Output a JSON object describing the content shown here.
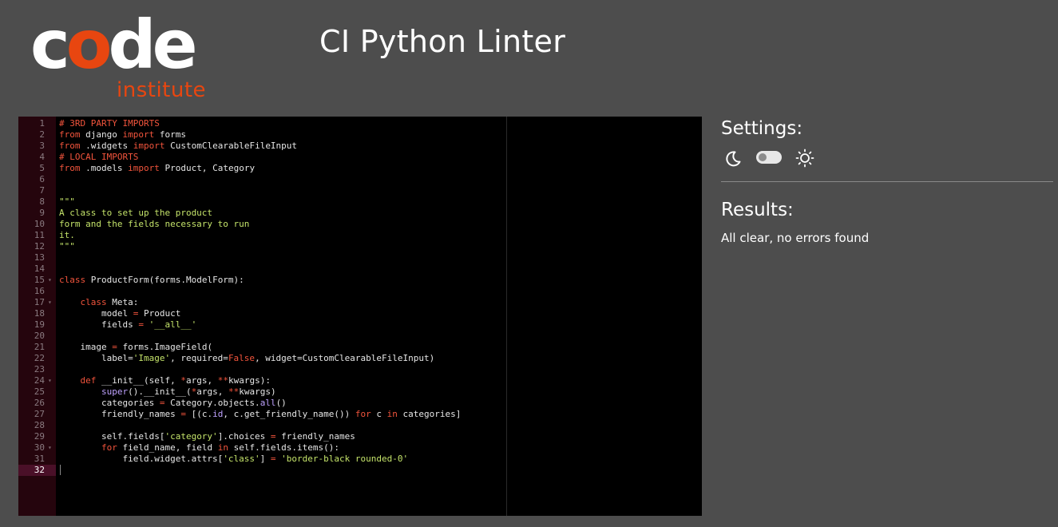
{
  "logo": {
    "word_c": "c",
    "word_o": "o",
    "word_de": "de",
    "subtitle": "institute"
  },
  "app": {
    "title": "CI Python Linter"
  },
  "colors": {
    "brand_orange": "#e84610",
    "background": "#4d4d4d",
    "editor_bg": "#000000",
    "gutter_bg": "#25050d",
    "keyword": "#f2543c",
    "string": "#c4e36a",
    "builtin": "#bfa2ff"
  },
  "editor": {
    "active_line": 32,
    "lines": [
      {
        "n": "1",
        "fold": "",
        "tokens": [
          {
            "c": "cm",
            "t": "# 3RD PARTY IMPORTS"
          }
        ]
      },
      {
        "n": "2",
        "fold": "",
        "tokens": [
          {
            "c": "kw",
            "t": "from"
          },
          {
            "c": "pl",
            "t": " django "
          },
          {
            "c": "kw",
            "t": "import"
          },
          {
            "c": "pl",
            "t": " forms"
          }
        ]
      },
      {
        "n": "3",
        "fold": "",
        "tokens": [
          {
            "c": "kw",
            "t": "from"
          },
          {
            "c": "pl",
            "t": " .widgets "
          },
          {
            "c": "kw",
            "t": "import"
          },
          {
            "c": "pl",
            "t": " CustomClearableFileInput"
          }
        ]
      },
      {
        "n": "4",
        "fold": "",
        "tokens": [
          {
            "c": "cm",
            "t": "# LOCAL IMPORTS"
          }
        ]
      },
      {
        "n": "5",
        "fold": "",
        "tokens": [
          {
            "c": "kw",
            "t": "from"
          },
          {
            "c": "pl",
            "t": " .models "
          },
          {
            "c": "kw",
            "t": "import"
          },
          {
            "c": "pl",
            "t": " Product, Category"
          }
        ]
      },
      {
        "n": "6",
        "fold": "",
        "tokens": []
      },
      {
        "n": "7",
        "fold": "",
        "tokens": []
      },
      {
        "n": "8",
        "fold": "",
        "tokens": [
          {
            "c": "st",
            "t": "\"\"\""
          }
        ]
      },
      {
        "n": "9",
        "fold": "",
        "tokens": [
          {
            "c": "st",
            "t": "A class to set up the product"
          }
        ]
      },
      {
        "n": "10",
        "fold": "",
        "tokens": [
          {
            "c": "st",
            "t": "form and the fields necessary to run"
          }
        ]
      },
      {
        "n": "11",
        "fold": "",
        "tokens": [
          {
            "c": "st",
            "t": "it."
          }
        ]
      },
      {
        "n": "12",
        "fold": "",
        "tokens": [
          {
            "c": "st",
            "t": "\"\"\""
          }
        ]
      },
      {
        "n": "13",
        "fold": "",
        "tokens": []
      },
      {
        "n": "14",
        "fold": "",
        "tokens": []
      },
      {
        "n": "15",
        "fold": "▾",
        "tokens": [
          {
            "c": "kw",
            "t": "class"
          },
          {
            "c": "pl",
            "t": " ProductForm(forms.ModelForm):"
          }
        ]
      },
      {
        "n": "16",
        "fold": "",
        "tokens": []
      },
      {
        "n": "17",
        "fold": "▾",
        "tokens": [
          {
            "c": "pl",
            "t": "    "
          },
          {
            "c": "kw",
            "t": "class"
          },
          {
            "c": "pl",
            "t": " Meta:"
          }
        ]
      },
      {
        "n": "18",
        "fold": "",
        "tokens": [
          {
            "c": "pl",
            "t": "        model "
          },
          {
            "c": "kw",
            "t": "="
          },
          {
            "c": "pl",
            "t": " Product"
          }
        ]
      },
      {
        "n": "19",
        "fold": "",
        "tokens": [
          {
            "c": "pl",
            "t": "        fields "
          },
          {
            "c": "kw",
            "t": "="
          },
          {
            "c": "pl",
            "t": " "
          },
          {
            "c": "st",
            "t": "'__all__'"
          }
        ]
      },
      {
        "n": "20",
        "fold": "",
        "tokens": []
      },
      {
        "n": "21",
        "fold": "",
        "tokens": [
          {
            "c": "pl",
            "t": "    image "
          },
          {
            "c": "kw",
            "t": "="
          },
          {
            "c": "pl",
            "t": " forms.ImageField("
          }
        ]
      },
      {
        "n": "22",
        "fold": "",
        "tokens": [
          {
            "c": "pl",
            "t": "        label="
          },
          {
            "c": "st",
            "t": "'Image'"
          },
          {
            "c": "pl",
            "t": ", required="
          },
          {
            "c": "kw",
            "t": "False"
          },
          {
            "c": "pl",
            "t": ", widget="
          },
          {
            "c": "pl",
            "t": "CustomClearableFileInput)"
          }
        ]
      },
      {
        "n": "23",
        "fold": "",
        "tokens": []
      },
      {
        "n": "24",
        "fold": "▾",
        "tokens": [
          {
            "c": "pl",
            "t": "    "
          },
          {
            "c": "kw",
            "t": "def"
          },
          {
            "c": "pl",
            "t": " __init__(self, "
          },
          {
            "c": "kw",
            "t": "*"
          },
          {
            "c": "pl",
            "t": "args, "
          },
          {
            "c": "kw",
            "t": "**"
          },
          {
            "c": "pl",
            "t": "kwargs):"
          }
        ]
      },
      {
        "n": "25",
        "fold": "",
        "tokens": [
          {
            "c": "pl",
            "t": "        "
          },
          {
            "c": "fn",
            "t": "super"
          },
          {
            "c": "pl",
            "t": "().__init__("
          },
          {
            "c": "kw",
            "t": "*"
          },
          {
            "c": "pl",
            "t": "args, "
          },
          {
            "c": "kw",
            "t": "**"
          },
          {
            "c": "pl",
            "t": "kwargs)"
          }
        ]
      },
      {
        "n": "26",
        "fold": "",
        "tokens": [
          {
            "c": "pl",
            "t": "        categories "
          },
          {
            "c": "kw",
            "t": "="
          },
          {
            "c": "pl",
            "t": " Category.objects."
          },
          {
            "c": "fn",
            "t": "all"
          },
          {
            "c": "pl",
            "t": "()"
          }
        ]
      },
      {
        "n": "27",
        "fold": "",
        "tokens": [
          {
            "c": "pl",
            "t": "        friendly_names "
          },
          {
            "c": "kw",
            "t": "="
          },
          {
            "c": "pl",
            "t": " [(c."
          },
          {
            "c": "fn",
            "t": "id"
          },
          {
            "c": "pl",
            "t": ", c.get_friendly_name()) "
          },
          {
            "c": "kw",
            "t": "for"
          },
          {
            "c": "pl",
            "t": " c "
          },
          {
            "c": "kw",
            "t": "in"
          },
          {
            "c": "pl",
            "t": " categories]"
          }
        ]
      },
      {
        "n": "28",
        "fold": "",
        "tokens": []
      },
      {
        "n": "29",
        "fold": "",
        "tokens": [
          {
            "c": "pl",
            "t": "        self.fields["
          },
          {
            "c": "st",
            "t": "'category'"
          },
          {
            "c": "pl",
            "t": "].choices "
          },
          {
            "c": "kw",
            "t": "="
          },
          {
            "c": "pl",
            "t": " friendly_names"
          }
        ]
      },
      {
        "n": "30",
        "fold": "▾",
        "tokens": [
          {
            "c": "pl",
            "t": "        "
          },
          {
            "c": "kw",
            "t": "for"
          },
          {
            "c": "pl",
            "t": " field_name, field "
          },
          {
            "c": "kw",
            "t": "in"
          },
          {
            "c": "pl",
            "t": " self.fields.items():"
          }
        ]
      },
      {
        "n": "31",
        "fold": "",
        "tokens": [
          {
            "c": "pl",
            "t": "            field.widget.attrs["
          },
          {
            "c": "st",
            "t": "'class'"
          },
          {
            "c": "pl",
            "t": "] "
          },
          {
            "c": "kw",
            "t": "="
          },
          {
            "c": "pl",
            "t": " "
          },
          {
            "c": "st",
            "t": "'border-black rounded-0'"
          }
        ]
      },
      {
        "n": "32",
        "fold": "",
        "tokens": []
      }
    ]
  },
  "settings": {
    "title": "Settings:",
    "dark_icon": "moon-icon",
    "light_icon": "sun-icon",
    "theme_toggle_on": false
  },
  "results": {
    "title": "Results:",
    "message": "All clear, no errors found"
  }
}
